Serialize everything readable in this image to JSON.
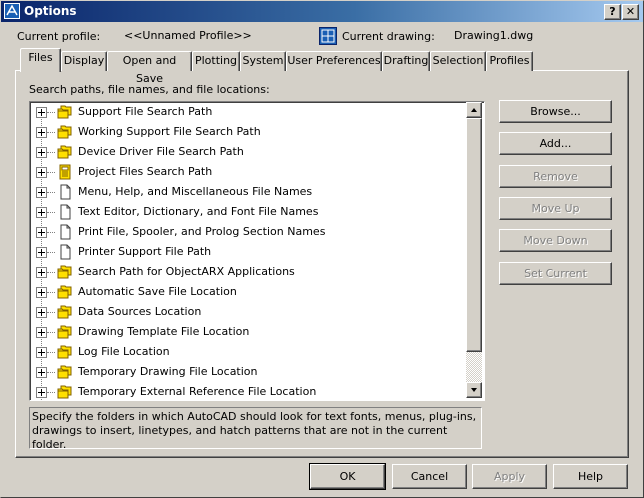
{
  "window": {
    "title": "Options",
    "help_glyph": "?",
    "close_glyph": "✕"
  },
  "profile": {
    "label": "Current profile:",
    "value": "<<Unnamed Profile>>"
  },
  "drawing": {
    "label": "Current drawing:",
    "value": "Drawing1.dwg"
  },
  "tabs": [
    {
      "label": "Files",
      "active": true
    },
    {
      "label": "Display"
    },
    {
      "label": "Open and Save"
    },
    {
      "label": "Plotting"
    },
    {
      "label": "System"
    },
    {
      "label": "User Preferences"
    },
    {
      "label": "Drafting"
    },
    {
      "label": "Selection"
    },
    {
      "label": "Profiles"
    }
  ],
  "files": {
    "heading": "Search paths, file names, and file locations:",
    "items": [
      {
        "label": "Support File Search Path",
        "icon": "folders-icon"
      },
      {
        "label": "Working Support File Search Path",
        "icon": "folders-icon"
      },
      {
        "label": "Device Driver File Search Path",
        "icon": "folders-icon"
      },
      {
        "label": "Project Files Search Path",
        "icon": "project-icon"
      },
      {
        "label": "Menu, Help, and Miscellaneous File Names",
        "icon": "document-icon"
      },
      {
        "label": "Text Editor, Dictionary, and Font File Names",
        "icon": "document-icon"
      },
      {
        "label": "Print File, Spooler, and Prolog Section Names",
        "icon": "document-icon"
      },
      {
        "label": "Printer Support File Path",
        "icon": "document-icon"
      },
      {
        "label": "Search Path for ObjectARX Applications",
        "icon": "folders-icon"
      },
      {
        "label": "Automatic Save File Location",
        "icon": "folders-icon"
      },
      {
        "label": "Data Sources Location",
        "icon": "folders-icon"
      },
      {
        "label": "Drawing Template File Location",
        "icon": "folders-icon"
      },
      {
        "label": "Log File Location",
        "icon": "folders-icon"
      },
      {
        "label": "Temporary Drawing File Location",
        "icon": "folders-icon"
      },
      {
        "label": "Temporary External Reference File Location",
        "icon": "folders-icon"
      }
    ],
    "description": "Specify the folders in which AutoCAD should look for text fonts, menus, plug-ins, drawings to insert, linetypes, and hatch patterns that are not in the current folder."
  },
  "side_buttons": [
    {
      "label": "Browse...",
      "enabled": true
    },
    {
      "label": "Add...",
      "enabled": true
    },
    {
      "label": "Remove",
      "enabled": false
    },
    {
      "label": "Move Up",
      "enabled": false
    },
    {
      "label": "Move Down",
      "enabled": false
    },
    {
      "label": "Set Current",
      "enabled": false
    }
  ],
  "footer": {
    "ok": "OK",
    "cancel": "Cancel",
    "apply": "Apply",
    "help": "Help"
  },
  "colors": {
    "title_start": "#0a246a",
    "title_end": "#a6caf0",
    "face": "#d4d0c8",
    "folder": "#ffe000"
  }
}
